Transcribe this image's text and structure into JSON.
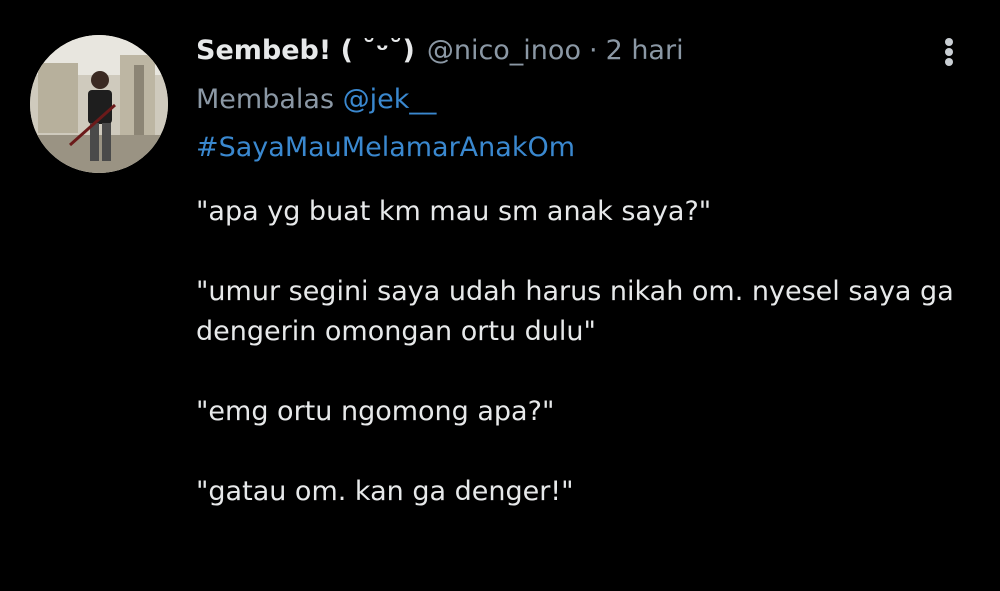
{
  "tweet": {
    "display_name": "Sembeb! ( ˘ᵕ˘)",
    "handle": "@nico_inoo",
    "separator": "·",
    "time": "2 hari",
    "reply_prefix": "Membalas",
    "reply_to": "@jek__",
    "hashtag": "#SayaMauMelamarAnakOm",
    "paragraphs": [
      "\"apa yg buat km mau sm anak saya?\"",
      "\"umur segini saya udah harus nikah om. nyesel saya ga dengerin omongan ortu dulu\"",
      "\"emg ortu ngomong apa?\"",
      "\"gatau om. kan ga denger!\""
    ]
  },
  "icons": {
    "more": "more-vertical-icon"
  },
  "colors": {
    "background": "#000000",
    "text": "#e7e9ea",
    "secondary": "#8b98a5",
    "link": "#3a88cf"
  }
}
